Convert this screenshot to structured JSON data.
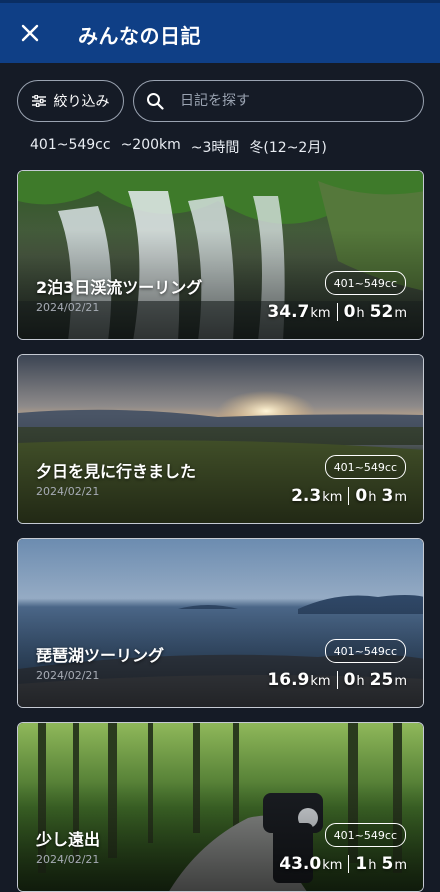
{
  "header": {
    "title": "みんなの日記",
    "close_icon": "close-icon"
  },
  "filter_button": {
    "label": "絞り込み",
    "icon": "sliders-icon"
  },
  "search": {
    "placeholder": "日記を探す",
    "icon": "search-icon"
  },
  "active_filters": [
    "401~549cc",
    "~200km",
    "~3時間",
    "冬(12~2月)"
  ],
  "cards": [
    {
      "title": "2泊3日渓流ツーリング",
      "date": "2024/02/21",
      "cc": "401~549cc",
      "distance": "34.7",
      "distance_unit": "km",
      "hours": "0",
      "hours_unit": "h",
      "minutes": "52",
      "minutes_unit": "m"
    },
    {
      "title": "夕日を見に行きました",
      "date": "2024/02/21",
      "cc": "401~549cc",
      "distance": "2.3",
      "distance_unit": "km",
      "hours": "0",
      "hours_unit": "h",
      "minutes": "3",
      "minutes_unit": "m"
    },
    {
      "title": "琵琶湖ツーリング",
      "date": "2024/02/21",
      "cc": "401~549cc",
      "distance": "16.9",
      "distance_unit": "km",
      "hours": "0",
      "hours_unit": "h",
      "minutes": "25",
      "minutes_unit": "m"
    },
    {
      "title": "少し遠出",
      "date": "2024/02/21",
      "cc": "401~549cc",
      "distance": "43.0",
      "distance_unit": "km",
      "hours": "1",
      "hours_unit": "h",
      "minutes": "5",
      "minutes_unit": "m"
    }
  ]
}
